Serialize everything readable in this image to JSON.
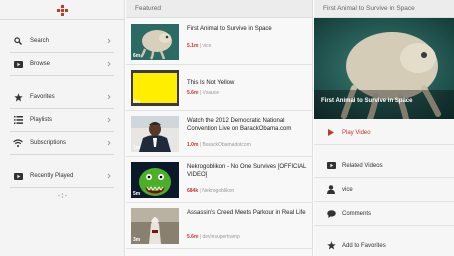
{
  "colors": {
    "accent": "#c0392b",
    "sidebar_bg": "#f4f4f4",
    "panel_bg": "#f8f8f8"
  },
  "sidebar": {
    "items": [
      {
        "label": "Search",
        "icon": "search-icon"
      },
      {
        "label": "Browse",
        "icon": "play-square-icon"
      },
      {
        "label": "Favorites",
        "icon": "star-icon"
      },
      {
        "label": "Playlists",
        "icon": "list-icon"
      },
      {
        "label": "Subscriptions",
        "icon": "wifi-icon"
      },
      {
        "label": "Recently Played",
        "icon": "play-square-icon"
      }
    ]
  },
  "featured": {
    "header": "Featured",
    "videos": [
      {
        "title": "First Animal to Survive in Space",
        "views": "5.1m",
        "channel": "vice",
        "duration": "6m"
      },
      {
        "title": "This Is Not Yellow",
        "views": "5.6m",
        "channel": "Vsauce",
        "duration": "8m"
      },
      {
        "title": "Watch the 2012 Democratic National Convention Live on BarackObama.com",
        "views": "1.0m",
        "channel": "BarackObamadotcom",
        "duration": "1m"
      },
      {
        "title": "Nekrogoblikon - No One Survives [OFFICIAL VIDEO]",
        "views": "684k",
        "channel": "Nekrogoblikon",
        "duration": "5m"
      },
      {
        "title": "Assassin's Creed Meets Parkour in Real Life",
        "views": "5.6m",
        "channel": "devinsupertramp",
        "duration": "3m"
      }
    ]
  },
  "detail": {
    "header": "First Animal to Survive in Space",
    "hero_caption": "First Animal to Survive in Space",
    "actions": [
      {
        "label": "Play Video",
        "icon": "play-icon"
      },
      {
        "label": "Related Videos",
        "icon": "play-square-icon"
      },
      {
        "label": "vice",
        "icon": "user-icon"
      },
      {
        "label": "Comments",
        "icon": "comment-icon"
      },
      {
        "label": "Add to Favorites",
        "icon": "star-icon"
      }
    ]
  }
}
